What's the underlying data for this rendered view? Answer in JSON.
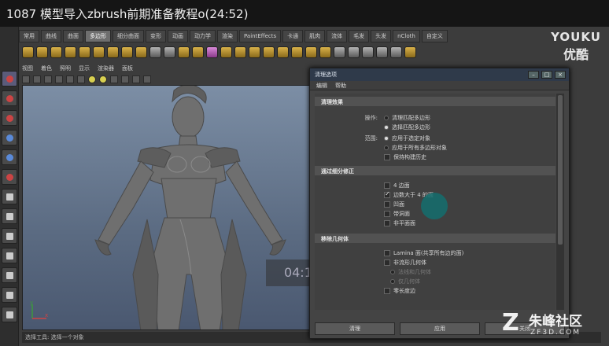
{
  "video": {
    "title": "1087 模型导入zbrush前期准备教程o(24:52)"
  },
  "shelf": {
    "tabs": [
      "常用",
      "曲线",
      "曲面",
      "多边形",
      "细分曲面",
      "变形",
      "动画",
      "动力学",
      "渲染",
      "PaintEffects",
      "卡通",
      "肌肉",
      "流体",
      "毛发",
      "头发",
      "nCloth",
      "自定义"
    ],
    "active_tab_index": 3
  },
  "panel": {
    "menu": [
      "视图",
      "着色",
      "照明",
      "显示",
      "渲染器",
      "面板"
    ]
  },
  "viewport": {
    "timecode": "04:17",
    "axis": {
      "x": "x",
      "y": "y"
    }
  },
  "status_bar": {
    "text": "选择工具: 选择一个对象"
  },
  "dialog": {
    "title": "清理选项",
    "menu": [
      "编辑",
      "帮助"
    ],
    "section1": {
      "title": "清理效果",
      "op_label": "操作:",
      "op_options": [
        {
          "label": "清理匹配多边形",
          "on": false
        },
        {
          "label": "选择匹配多边形",
          "on": true
        }
      ],
      "range_label": "范围:",
      "range_options": [
        {
          "label": "应用于选定对象",
          "on": true
        },
        {
          "label": "应用于所有多边形对象",
          "on": false
        }
      ],
      "history_label": "保持构建历史"
    },
    "section2": {
      "title": "通过细分修正",
      "options": [
        {
          "label": "4 边面",
          "on": false
        },
        {
          "label": "边数大于 4 的面",
          "on": true
        },
        {
          "label": "凹面",
          "on": false
        },
        {
          "label": "带洞面",
          "on": false
        },
        {
          "label": "非平面面",
          "on": false
        }
      ]
    },
    "section3": {
      "title": "移除几何体",
      "options": [
        {
          "label": "Lamina 面(共享所有边的面)",
          "on": false,
          "disabled": false
        },
        {
          "label": "非流形几何体",
          "on": false,
          "disabled": false
        },
        {
          "label": "法线和几何体",
          "on": false,
          "disabled": true
        },
        {
          "label": "仅几何体",
          "on": false,
          "disabled": true
        },
        {
          "label": "零长度边",
          "on": false,
          "disabled": false
        }
      ]
    },
    "buttons": [
      "清理",
      "应用",
      "关闭"
    ]
  },
  "watermark": {
    "youku_en": "YOUKU",
    "youku_cn": "优酷",
    "brand_name": "朱峰社区",
    "brand_url": "ZF3D.COM"
  },
  "colors": {
    "viewport_top": "#7c8ea5",
    "viewport_bottom": "#4a5870",
    "highlight": "#146e6e"
  }
}
